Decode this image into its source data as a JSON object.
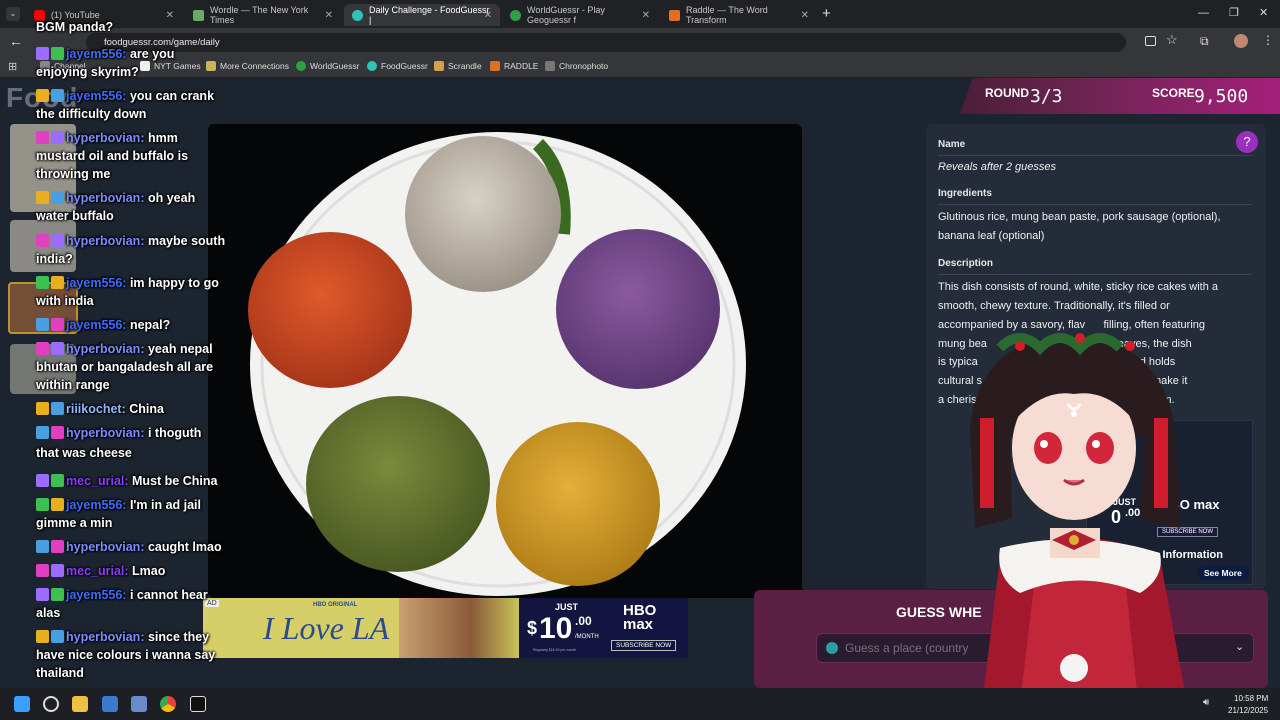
{
  "browser": {
    "tabs": [
      {
        "title": "(1) YouTube",
        "color": "#ff0000"
      },
      {
        "title": "Wordle — The New York Times",
        "color": "#ffffff"
      },
      {
        "title": "Daily Challenge - FoodGuessr |",
        "color": "#2ec4b6"
      },
      {
        "title": "WorldGuessr - Play Geoguessr f",
        "color": "#2ea043"
      },
      {
        "title": "Raddle — The Word Transform",
        "color": "#e07020"
      }
    ],
    "url": "foodguessr.com/game/daily",
    "new_tab": "+",
    "bookmarks": [
      "Channel",
      "NYT Games",
      "More Connections",
      "WorldGuessr",
      "FoodGuessr",
      "Scrandle",
      "RADDLE",
      "Chronophoto"
    ]
  },
  "site": {
    "logo": "Food",
    "round_label": "ROUND",
    "round_value": "3/3",
    "score_label": "SCORE",
    "score_value": "9,500",
    "help": "?",
    "info": {
      "name_heading": "Name",
      "name_value": "Reveals after 2 guesses",
      "ingredients_heading": "Ingredients",
      "ingredients_line1": "Glutinous rice, mung bean paste, pork sausage (optional),",
      "ingredients_line2": "banana leaf (optional)",
      "description_heading": "Description",
      "description_lines": [
        "This dish consists of round, white, sticky rice cakes with a",
        "smooth, chewy texture. Traditionally, it's filled or",
        "accompanied by a savory, flav      filling, often featuring",
        "mung bea                               anana leaves, the dish",
        "is typica                                  ccasions and holds",
        "cultural s                                istinctive taste make it",
        "a cherish                                   or breakfast item."
      ]
    },
    "guess_title": "GUESS WHE",
    "guess_placeholder": "Guess a place (country",
    "ad_right": {
      "just": "JUST",
      "price": "0",
      "cents": ".00",
      "brand": "HBO max",
      "sub": "SUBSCRIBE NOW",
      "more_info": "re Information",
      "see_more": "See More"
    },
    "ad_bottom": {
      "ad_tag": "AD",
      "title": "I Love LA",
      "hbo_original": "HBO ORIGINAL",
      "just": "JUST",
      "dollar": "$",
      "price": "10",
      "cents": ".00",
      "per": "/MONTH",
      "brand": "HBO max",
      "sub": "SUBSCRIBE NOW",
      "fine": "Regularly $18.49 per month"
    }
  },
  "chat": [
    {
      "user": "",
      "text": "BGM panda?",
      "ucls": ""
    },
    {
      "user": "jayem556:",
      "text": "are you",
      "ucls": "u-jayem"
    },
    {
      "user": "",
      "text": "enjoying skyrim?",
      "ucls": ""
    },
    {
      "user": "jayem556:",
      "text": "you can crank",
      "ucls": "u-jayem"
    },
    {
      "user": "",
      "text": "the difficulty down",
      "ucls": ""
    },
    {
      "user": "hyperbovian:",
      "text": "hmm",
      "ucls": "u-hyper"
    },
    {
      "user": "",
      "text": "mustard oil and buffalo is",
      "ucls": ""
    },
    {
      "user": "",
      "text": "throwing me",
      "ucls": ""
    },
    {
      "user": "hyperbovian:",
      "text": "oh yeah",
      "ucls": "u-hyper"
    },
    {
      "user": "",
      "text": "water buffalo",
      "ucls": ""
    },
    {
      "user": "hyperbovian:",
      "text": "maybe south",
      "ucls": "u-hyper"
    },
    {
      "user": "",
      "text": "india?",
      "ucls": ""
    },
    {
      "user": "jayem556:",
      "text": "im happy to go",
      "ucls": "u-jayem"
    },
    {
      "user": "",
      "text": "with india",
      "ucls": ""
    },
    {
      "user": "jayem556:",
      "text": "nepal?",
      "ucls": "u-jayem"
    },
    {
      "user": "hyperbovian:",
      "text": "yeah nepal",
      "ucls": "u-hyper"
    },
    {
      "user": "",
      "text": "bhutan or bangaladesh all are",
      "ucls": ""
    },
    {
      "user": "",
      "text": "within range",
      "ucls": ""
    },
    {
      "user": "riiikochet:",
      "text": "China",
      "ucls": "u-rili"
    },
    {
      "user": "hyperbovian:",
      "text": "i thoguth",
      "ucls": "u-hyper"
    },
    {
      "user": "",
      "text": "that was cheese",
      "ucls": ""
    },
    {
      "user": "mec_urial:",
      "text": "Must be China",
      "ucls": "u-mec"
    },
    {
      "user": "jayem556:",
      "text": "I'm in ad jail",
      "ucls": "u-jayem"
    },
    {
      "user": "",
      "text": "gimme a min",
      "ucls": ""
    },
    {
      "user": "hyperbovian:",
      "text": "caught lmao",
      "ucls": "u-hyper"
    },
    {
      "user": "mec_urial:",
      "text": "Lmao",
      "ucls": "u-mec"
    },
    {
      "user": "jayem556:",
      "text": "i cannot hear",
      "ucls": "u-jayem"
    },
    {
      "user": "",
      "text": "alas",
      "ucls": ""
    },
    {
      "user": "hyperbovian:",
      "text": "since they",
      "ucls": "u-hyper"
    },
    {
      "user": "",
      "text": "have nice colours i wanna say",
      "ucls": ""
    },
    {
      "user": "",
      "text": "thailand",
      "ucls": ""
    }
  ],
  "taskbar": {
    "time": "10:58 PM",
    "date": "21/12/2025"
  },
  "colors": {
    "accent": "#a4207a",
    "help": "#9b30c0",
    "guess_panel": "#5b1f44"
  }
}
